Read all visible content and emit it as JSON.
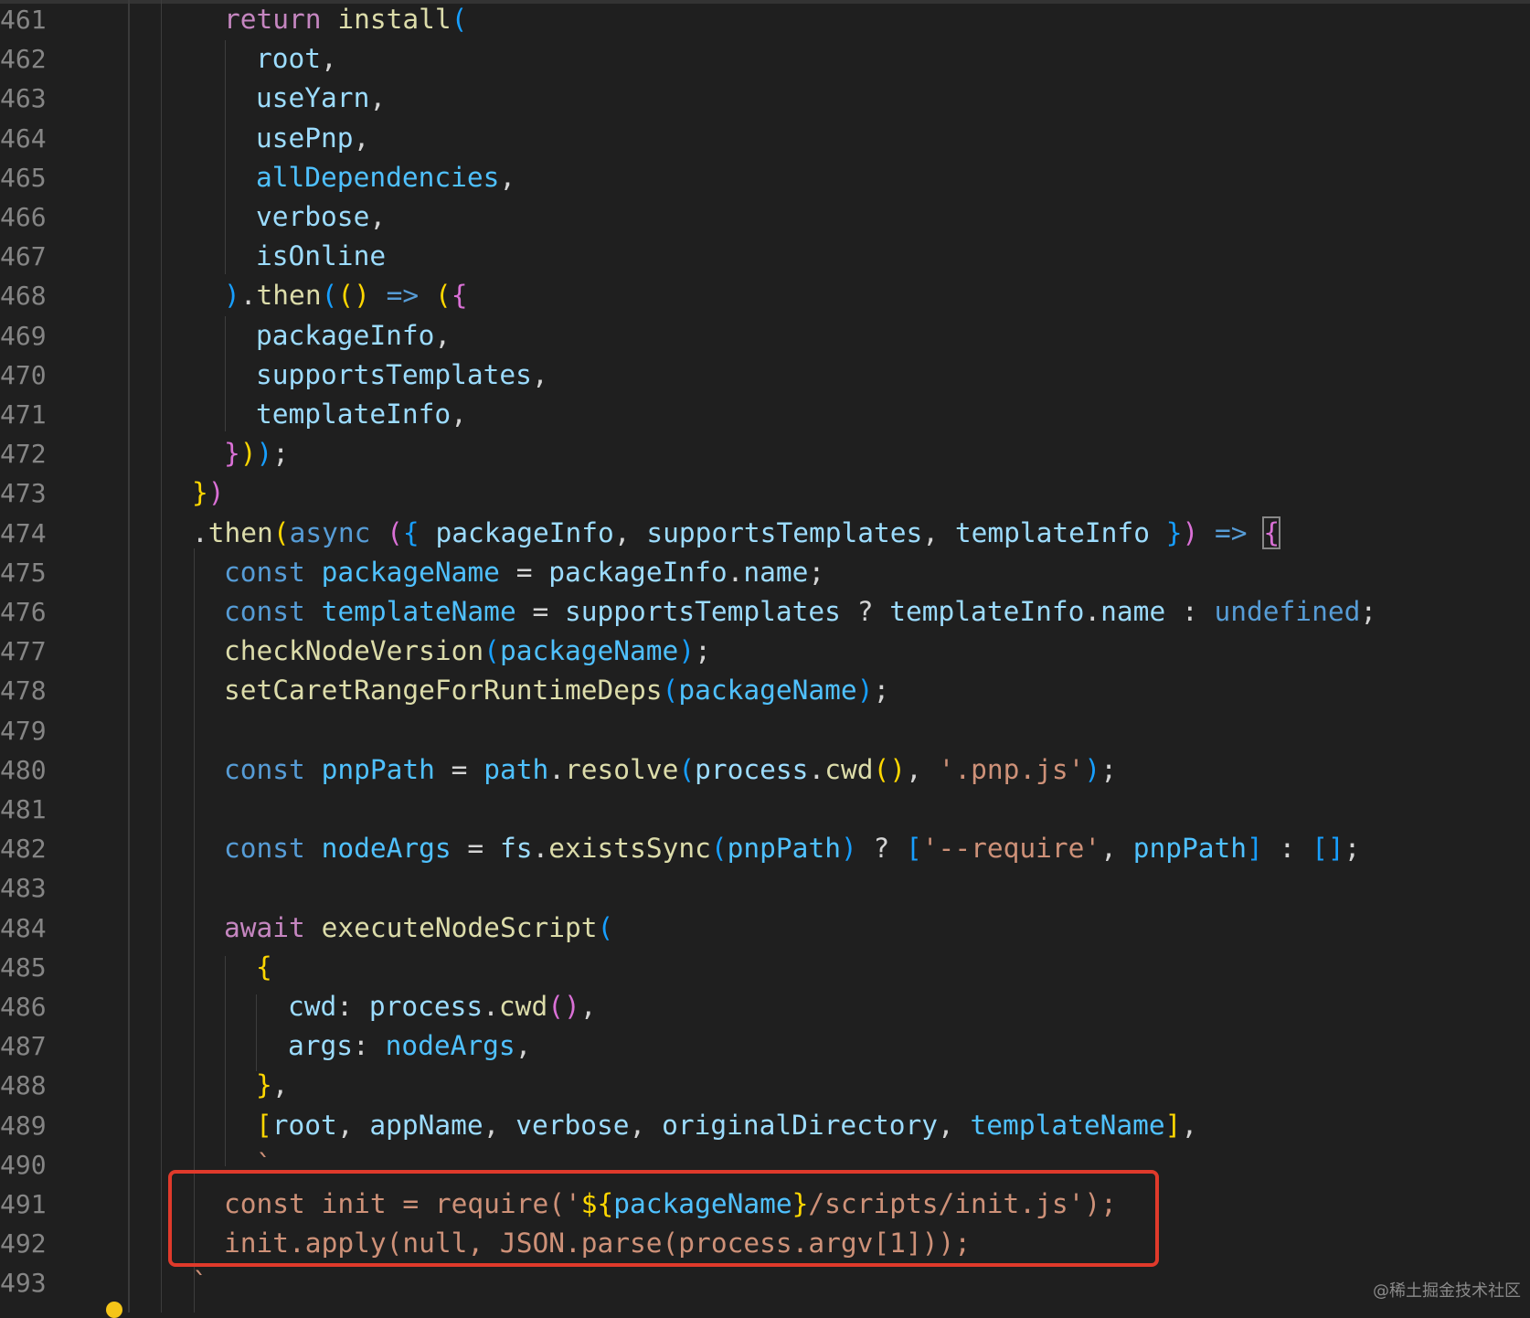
{
  "editor": {
    "lines": [
      {
        "num": "461",
        "tokens": [
          {
            "t": "return",
            "c": "kw"
          },
          {
            "t": " "
          },
          {
            "t": "install",
            "c": "fn"
          },
          {
            "t": "(",
            "c": "b3"
          }
        ],
        "indent": 1
      },
      {
        "num": "462",
        "tokens": [
          {
            "t": "root",
            "c": "var"
          },
          {
            "t": ","
          }
        ],
        "indent": 2
      },
      {
        "num": "463",
        "tokens": [
          {
            "t": "useYarn",
            "c": "var"
          },
          {
            "t": ","
          }
        ],
        "indent": 2
      },
      {
        "num": "464",
        "tokens": [
          {
            "t": "usePnp",
            "c": "var"
          },
          {
            "t": ","
          }
        ],
        "indent": 2
      },
      {
        "num": "465",
        "tokens": [
          {
            "t": "allDependencies",
            "c": "cst"
          },
          {
            "t": ","
          }
        ],
        "indent": 2
      },
      {
        "num": "466",
        "tokens": [
          {
            "t": "verbose",
            "c": "var"
          },
          {
            "t": ","
          }
        ],
        "indent": 2
      },
      {
        "num": "467",
        "tokens": [
          {
            "t": "isOnline",
            "c": "var"
          }
        ],
        "indent": 2
      },
      {
        "num": "468",
        "tokens": [
          {
            "t": ")",
            "c": "b3"
          },
          {
            "t": "."
          },
          {
            "t": "then",
            "c": "fn"
          },
          {
            "t": "(",
            "c": "b3"
          },
          {
            "t": "()",
            "c": "b1"
          },
          {
            "t": " "
          },
          {
            "t": "=>",
            "c": "st"
          },
          {
            "t": " "
          },
          {
            "t": "(",
            "c": "b1"
          },
          {
            "t": "{",
            "c": "b2"
          }
        ],
        "indent": 1
      },
      {
        "num": "469",
        "tokens": [
          {
            "t": "packageInfo",
            "c": "var"
          },
          {
            "t": ","
          }
        ],
        "indent": 2
      },
      {
        "num": "470",
        "tokens": [
          {
            "t": "supportsTemplates",
            "c": "var"
          },
          {
            "t": ","
          }
        ],
        "indent": 2
      },
      {
        "num": "471",
        "tokens": [
          {
            "t": "templateInfo",
            "c": "var"
          },
          {
            "t": ","
          }
        ],
        "indent": 2
      },
      {
        "num": "472",
        "tokens": [
          {
            "t": "}",
            "c": "b2"
          },
          {
            "t": ")",
            "c": "b1"
          },
          {
            "t": ")",
            "c": "b3"
          },
          {
            "t": ";"
          }
        ],
        "indent": 1
      },
      {
        "num": "473",
        "tokens": [
          {
            "t": "}",
            "c": "b1"
          },
          {
            "t": ")",
            "c": "b2"
          }
        ],
        "indent": 0
      },
      {
        "num": "474",
        "tokens": [
          {
            "t": "."
          },
          {
            "t": "then",
            "c": "fn"
          },
          {
            "t": "(",
            "c": "b1"
          },
          {
            "t": "async",
            "c": "st"
          },
          {
            "t": " "
          },
          {
            "t": "(",
            "c": "b2"
          },
          {
            "t": "{",
            "c": "b3"
          },
          {
            "t": " "
          },
          {
            "t": "packageInfo",
            "c": "var"
          },
          {
            "t": ", "
          },
          {
            "t": "supportsTemplates",
            "c": "var"
          },
          {
            "t": ", "
          },
          {
            "t": "templateInfo",
            "c": "var"
          },
          {
            "t": " "
          },
          {
            "t": "}",
            "c": "b3"
          },
          {
            "t": ")",
            "c": "b2"
          },
          {
            "t": " "
          },
          {
            "t": "=>",
            "c": "st"
          },
          {
            "t": " "
          },
          {
            "t": "{",
            "c": "b2",
            "m": true
          }
        ],
        "indent": 0
      },
      {
        "num": "475",
        "tokens": [
          {
            "t": "const",
            "c": "st"
          },
          {
            "t": " "
          },
          {
            "t": "packageName",
            "c": "cst"
          },
          {
            "t": " = "
          },
          {
            "t": "packageInfo",
            "c": "var"
          },
          {
            "t": "."
          },
          {
            "t": "name",
            "c": "var"
          },
          {
            "t": ";"
          }
        ],
        "indent": 1
      },
      {
        "num": "476",
        "tokens": [
          {
            "t": "const",
            "c": "st"
          },
          {
            "t": " "
          },
          {
            "t": "templateName",
            "c": "cst"
          },
          {
            "t": " = "
          },
          {
            "t": "supportsTemplates",
            "c": "var"
          },
          {
            "t": " ? "
          },
          {
            "t": "templateInfo",
            "c": "var"
          },
          {
            "t": "."
          },
          {
            "t": "name",
            "c": "var"
          },
          {
            "t": " : "
          },
          {
            "t": "undefined",
            "c": "st"
          },
          {
            "t": ";"
          }
        ],
        "indent": 1
      },
      {
        "num": "477",
        "tokens": [
          {
            "t": "checkNodeVersion",
            "c": "fn"
          },
          {
            "t": "(",
            "c": "b3"
          },
          {
            "t": "packageName",
            "c": "cst"
          },
          {
            "t": ")",
            "c": "b3"
          },
          {
            "t": ";"
          }
        ],
        "indent": 1
      },
      {
        "num": "478",
        "tokens": [
          {
            "t": "setCaretRangeForRuntimeDeps",
            "c": "fn"
          },
          {
            "t": "(",
            "c": "b3"
          },
          {
            "t": "packageName",
            "c": "cst"
          },
          {
            "t": ")",
            "c": "b3"
          },
          {
            "t": ";"
          }
        ],
        "indent": 1
      },
      {
        "num": "479",
        "tokens": [],
        "indent": 1
      },
      {
        "num": "480",
        "tokens": [
          {
            "t": "const",
            "c": "st"
          },
          {
            "t": " "
          },
          {
            "t": "pnpPath",
            "c": "cst"
          },
          {
            "t": " = "
          },
          {
            "t": "path",
            "c": "cst"
          },
          {
            "t": "."
          },
          {
            "t": "resolve",
            "c": "fn"
          },
          {
            "t": "(",
            "c": "b3"
          },
          {
            "t": "process",
            "c": "var"
          },
          {
            "t": "."
          },
          {
            "t": "cwd",
            "c": "fn"
          },
          {
            "t": "()",
            "c": "b1"
          },
          {
            "t": ", "
          },
          {
            "t": "'.pnp.js'",
            "c": "str"
          },
          {
            "t": ")",
            "c": "b3"
          },
          {
            "t": ";"
          }
        ],
        "indent": 1
      },
      {
        "num": "481",
        "tokens": [],
        "indent": 1
      },
      {
        "num": "482",
        "tokens": [
          {
            "t": "const",
            "c": "st"
          },
          {
            "t": " "
          },
          {
            "t": "nodeArgs",
            "c": "cst"
          },
          {
            "t": " = "
          },
          {
            "t": "fs",
            "c": "var"
          },
          {
            "t": "."
          },
          {
            "t": "existsSync",
            "c": "fn"
          },
          {
            "t": "(",
            "c": "b3"
          },
          {
            "t": "pnpPath",
            "c": "cst"
          },
          {
            "t": ")",
            "c": "b3"
          },
          {
            "t": " ? "
          },
          {
            "t": "[",
            "c": "b3"
          },
          {
            "t": "'--require'",
            "c": "str"
          },
          {
            "t": ", "
          },
          {
            "t": "pnpPath",
            "c": "cst"
          },
          {
            "t": "]",
            "c": "b3"
          },
          {
            "t": " : "
          },
          {
            "t": "[]",
            "c": "b3"
          },
          {
            "t": ";"
          }
        ],
        "indent": 1
      },
      {
        "num": "483",
        "tokens": [],
        "indent": 1
      },
      {
        "num": "484",
        "tokens": [
          {
            "t": "await",
            "c": "kw"
          },
          {
            "t": " "
          },
          {
            "t": "executeNodeScript",
            "c": "fn"
          },
          {
            "t": "(",
            "c": "b3"
          }
        ],
        "indent": 1
      },
      {
        "num": "485",
        "tokens": [
          {
            "t": "{",
            "c": "b1"
          }
        ],
        "indent": 2
      },
      {
        "num": "486",
        "tokens": [
          {
            "t": "cwd",
            "c": "var"
          },
          {
            "t": ": "
          },
          {
            "t": "process",
            "c": "var"
          },
          {
            "t": "."
          },
          {
            "t": "cwd",
            "c": "fn"
          },
          {
            "t": "()",
            "c": "b2"
          },
          {
            "t": ","
          }
        ],
        "indent": 3
      },
      {
        "num": "487",
        "tokens": [
          {
            "t": "args",
            "c": "var"
          },
          {
            "t": ": "
          },
          {
            "t": "nodeArgs",
            "c": "cst"
          },
          {
            "t": ","
          }
        ],
        "indent": 3
      },
      {
        "num": "488",
        "tokens": [
          {
            "t": "}",
            "c": "b1"
          },
          {
            "t": ","
          }
        ],
        "indent": 2
      },
      {
        "num": "489",
        "tokens": [
          {
            "t": "[",
            "c": "b1"
          },
          {
            "t": "root",
            "c": "var"
          },
          {
            "t": ", "
          },
          {
            "t": "appName",
            "c": "var"
          },
          {
            "t": ", "
          },
          {
            "t": "verbose",
            "c": "var"
          },
          {
            "t": ", "
          },
          {
            "t": "originalDirectory",
            "c": "var"
          },
          {
            "t": ", "
          },
          {
            "t": "templateName",
            "c": "cst"
          },
          {
            "t": "]",
            "c": "b1"
          },
          {
            "t": ","
          }
        ],
        "indent": 2
      },
      {
        "num": "490",
        "tokens": [
          {
            "t": "`",
            "c": "str"
          }
        ],
        "indent": 2
      },
      {
        "num": "491",
        "tokens": [
          {
            "t": "const init = require('",
            "c": "str"
          },
          {
            "t": "${",
            "c": "b1"
          },
          {
            "t": "packageName",
            "c": "cst"
          },
          {
            "t": "}",
            "c": "b1"
          },
          {
            "t": "/scripts/init.js');",
            "c": "str"
          }
        ],
        "indent": 1
      },
      {
        "num": "492",
        "tokens": [
          {
            "t": "init.apply(null, JSON.parse(process.argv[1]));",
            "c": "str"
          }
        ],
        "indent": 1
      },
      {
        "num": "493",
        "tokens": [
          {
            "t": "`",
            "c": "str"
          }
        ],
        "indent": 0
      }
    ]
  },
  "watermark": "@稀土掘金技术社区",
  "colors": {
    "highlight_border": "#e03a2b",
    "background": "#1f1f1f"
  }
}
